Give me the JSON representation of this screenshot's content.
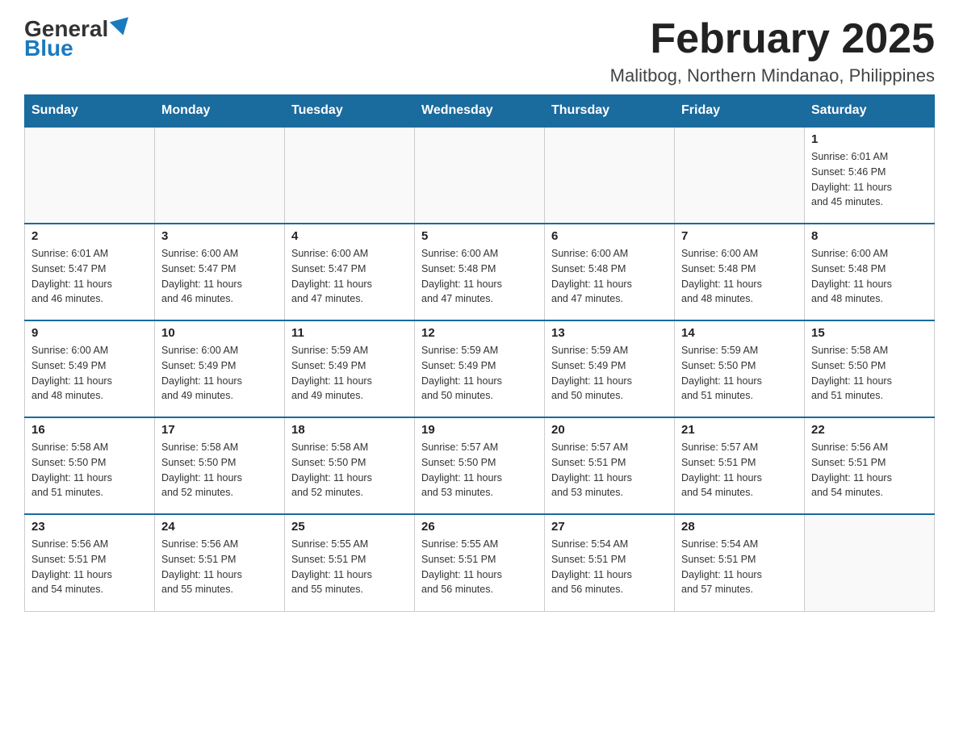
{
  "header": {
    "logo_general": "General",
    "logo_blue": "Blue",
    "month_title": "February 2025",
    "location": "Malitbog, Northern Mindanao, Philippines"
  },
  "calendar": {
    "days_of_week": [
      "Sunday",
      "Monday",
      "Tuesday",
      "Wednesday",
      "Thursday",
      "Friday",
      "Saturday"
    ],
    "weeks": [
      [
        {
          "day": "",
          "info": ""
        },
        {
          "day": "",
          "info": ""
        },
        {
          "day": "",
          "info": ""
        },
        {
          "day": "",
          "info": ""
        },
        {
          "day": "",
          "info": ""
        },
        {
          "day": "",
          "info": ""
        },
        {
          "day": "1",
          "info": "Sunrise: 6:01 AM\nSunset: 5:46 PM\nDaylight: 11 hours\nand 45 minutes."
        }
      ],
      [
        {
          "day": "2",
          "info": "Sunrise: 6:01 AM\nSunset: 5:47 PM\nDaylight: 11 hours\nand 46 minutes."
        },
        {
          "day": "3",
          "info": "Sunrise: 6:00 AM\nSunset: 5:47 PM\nDaylight: 11 hours\nand 46 minutes."
        },
        {
          "day": "4",
          "info": "Sunrise: 6:00 AM\nSunset: 5:47 PM\nDaylight: 11 hours\nand 47 minutes."
        },
        {
          "day": "5",
          "info": "Sunrise: 6:00 AM\nSunset: 5:48 PM\nDaylight: 11 hours\nand 47 minutes."
        },
        {
          "day": "6",
          "info": "Sunrise: 6:00 AM\nSunset: 5:48 PM\nDaylight: 11 hours\nand 47 minutes."
        },
        {
          "day": "7",
          "info": "Sunrise: 6:00 AM\nSunset: 5:48 PM\nDaylight: 11 hours\nand 48 minutes."
        },
        {
          "day": "8",
          "info": "Sunrise: 6:00 AM\nSunset: 5:48 PM\nDaylight: 11 hours\nand 48 minutes."
        }
      ],
      [
        {
          "day": "9",
          "info": "Sunrise: 6:00 AM\nSunset: 5:49 PM\nDaylight: 11 hours\nand 48 minutes."
        },
        {
          "day": "10",
          "info": "Sunrise: 6:00 AM\nSunset: 5:49 PM\nDaylight: 11 hours\nand 49 minutes."
        },
        {
          "day": "11",
          "info": "Sunrise: 5:59 AM\nSunset: 5:49 PM\nDaylight: 11 hours\nand 49 minutes."
        },
        {
          "day": "12",
          "info": "Sunrise: 5:59 AM\nSunset: 5:49 PM\nDaylight: 11 hours\nand 50 minutes."
        },
        {
          "day": "13",
          "info": "Sunrise: 5:59 AM\nSunset: 5:49 PM\nDaylight: 11 hours\nand 50 minutes."
        },
        {
          "day": "14",
          "info": "Sunrise: 5:59 AM\nSunset: 5:50 PM\nDaylight: 11 hours\nand 51 minutes."
        },
        {
          "day": "15",
          "info": "Sunrise: 5:58 AM\nSunset: 5:50 PM\nDaylight: 11 hours\nand 51 minutes."
        }
      ],
      [
        {
          "day": "16",
          "info": "Sunrise: 5:58 AM\nSunset: 5:50 PM\nDaylight: 11 hours\nand 51 minutes."
        },
        {
          "day": "17",
          "info": "Sunrise: 5:58 AM\nSunset: 5:50 PM\nDaylight: 11 hours\nand 52 minutes."
        },
        {
          "day": "18",
          "info": "Sunrise: 5:58 AM\nSunset: 5:50 PM\nDaylight: 11 hours\nand 52 minutes."
        },
        {
          "day": "19",
          "info": "Sunrise: 5:57 AM\nSunset: 5:50 PM\nDaylight: 11 hours\nand 53 minutes."
        },
        {
          "day": "20",
          "info": "Sunrise: 5:57 AM\nSunset: 5:51 PM\nDaylight: 11 hours\nand 53 minutes."
        },
        {
          "day": "21",
          "info": "Sunrise: 5:57 AM\nSunset: 5:51 PM\nDaylight: 11 hours\nand 54 minutes."
        },
        {
          "day": "22",
          "info": "Sunrise: 5:56 AM\nSunset: 5:51 PM\nDaylight: 11 hours\nand 54 minutes."
        }
      ],
      [
        {
          "day": "23",
          "info": "Sunrise: 5:56 AM\nSunset: 5:51 PM\nDaylight: 11 hours\nand 54 minutes."
        },
        {
          "day": "24",
          "info": "Sunrise: 5:56 AM\nSunset: 5:51 PM\nDaylight: 11 hours\nand 55 minutes."
        },
        {
          "day": "25",
          "info": "Sunrise: 5:55 AM\nSunset: 5:51 PM\nDaylight: 11 hours\nand 55 minutes."
        },
        {
          "day": "26",
          "info": "Sunrise: 5:55 AM\nSunset: 5:51 PM\nDaylight: 11 hours\nand 56 minutes."
        },
        {
          "day": "27",
          "info": "Sunrise: 5:54 AM\nSunset: 5:51 PM\nDaylight: 11 hours\nand 56 minutes."
        },
        {
          "day": "28",
          "info": "Sunrise: 5:54 AM\nSunset: 5:51 PM\nDaylight: 11 hours\nand 57 minutes."
        },
        {
          "day": "",
          "info": ""
        }
      ]
    ]
  }
}
